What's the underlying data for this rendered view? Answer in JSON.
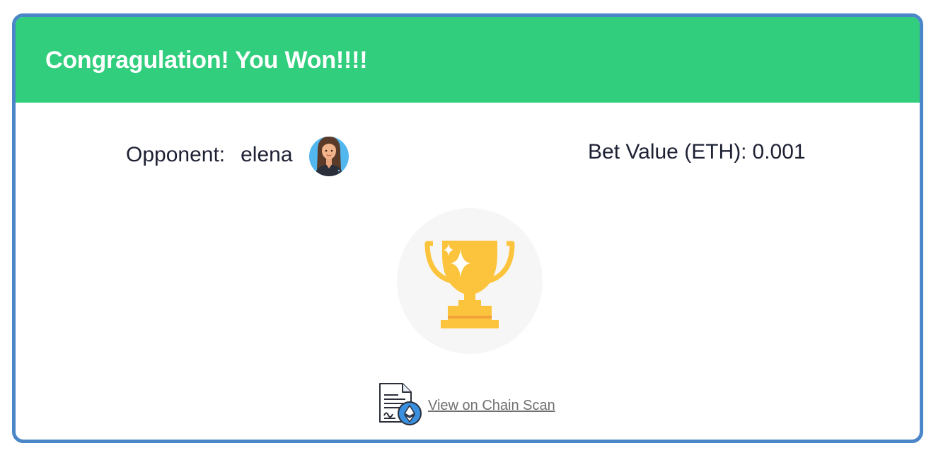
{
  "dialog": {
    "title": "Congragulation! You Won!!!!",
    "opponent_label": "Opponent:",
    "opponent_name": "elena",
    "bet_label": "Bet Value (ETH):",
    "bet_value": "0.001",
    "chain_scan_link": "View on Chain Scan"
  },
  "icons": {
    "avatar": "female-avatar-icon",
    "trophy": "trophy-icon",
    "document": "ethereum-document-icon"
  },
  "colors": {
    "header": "#31ce7d",
    "border": "#4a86c8",
    "trophy": "#fcc43d",
    "link": "#707070"
  }
}
